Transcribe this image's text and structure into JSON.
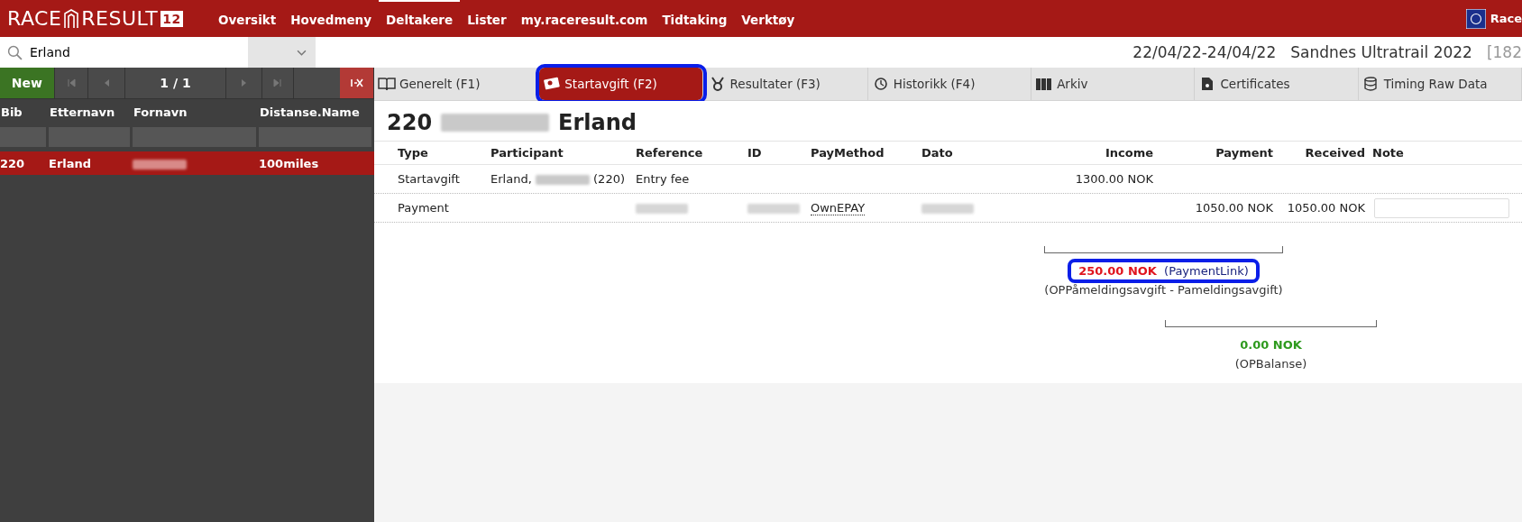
{
  "app": {
    "logo_left": "RACE",
    "logo_right": "RESULT",
    "version": "12",
    "user": "Race"
  },
  "menu": [
    {
      "label": "Oversikt",
      "selected": false
    },
    {
      "label": "Hovedmeny",
      "selected": false
    },
    {
      "label": "Deltakere",
      "selected": true
    },
    {
      "label": "Lister",
      "selected": false
    },
    {
      "label": "my.raceresult.com",
      "selected": false
    },
    {
      "label": "Tidtaking",
      "selected": false
    },
    {
      "label": "Verktøy",
      "selected": false
    }
  ],
  "search": {
    "value": "Erland"
  },
  "event": {
    "dates": "22/04/22-24/04/22",
    "name": "Sandnes Ultratrail 2022",
    "id": "[182"
  },
  "list": {
    "new_button": "New",
    "page": "1 / 1",
    "columns": [
      "Bib",
      "Etternavn",
      "Fornavn",
      "Distanse.Name"
    ],
    "rows": [
      {
        "selected": true,
        "cells": [
          {
            "kind": "text",
            "text": "220"
          },
          {
            "kind": "text",
            "text": "Erland"
          },
          {
            "kind": "redacted"
          },
          {
            "kind": "text",
            "text": "100miles"
          }
        ]
      }
    ]
  },
  "tabs": [
    {
      "label": "Generelt (F1)",
      "selected": false,
      "highlighted": false
    },
    {
      "label": "Startavgift (F2)",
      "selected": true,
      "highlighted": true
    },
    {
      "label": "Resultater (F3)",
      "selected": false,
      "highlighted": false
    },
    {
      "label": "Historikk (F4)",
      "selected": false,
      "highlighted": false
    },
    {
      "label": "Arkiv",
      "selected": false,
      "highlighted": false
    },
    {
      "label": "Certificates",
      "selected": false,
      "highlighted": false
    },
    {
      "label": "Timing Raw Data",
      "selected": false,
      "highlighted": false
    }
  ],
  "participant": {
    "bib": "220",
    "last_name": "Erland"
  },
  "fees": {
    "columns": [
      "Type",
      "Participant",
      "Reference",
      "ID",
      "PayMethod",
      "Dato",
      "Income",
      "Payment",
      "Received",
      "Note"
    ],
    "rows": [
      [
        {
          "kind": "text",
          "text": "Startavgift"
        },
        {
          "kind": "participant",
          "before": "Erland,",
          "after": "(220)"
        },
        {
          "kind": "text",
          "text": "Entry fee"
        },
        {
          "kind": "empty"
        },
        {
          "kind": "empty"
        },
        {
          "kind": "empty"
        },
        {
          "kind": "text",
          "text": "1300.00 NOK"
        },
        {
          "kind": "empty"
        },
        {
          "kind": "empty"
        },
        {
          "kind": "empty"
        }
      ],
      [
        {
          "kind": "text",
          "text": "Payment"
        },
        {
          "kind": "empty"
        },
        {
          "kind": "redacted"
        },
        {
          "kind": "redacted"
        },
        {
          "kind": "link",
          "text": "OwnEPAY"
        },
        {
          "kind": "redacted"
        },
        {
          "kind": "empty"
        },
        {
          "kind": "text",
          "text": "1050.00 NOK"
        },
        {
          "kind": "text",
          "text": "1050.00 NOK"
        },
        {
          "kind": "field"
        }
      ]
    ]
  },
  "summaries": [
    {
      "color": "#e0141e",
      "amount": "250.00 NOK",
      "link": "(PaymentLink)",
      "formula": "(OPPåmeldingsavgift - Pameldingsavgift)",
      "highlighted": true
    },
    {
      "color": "#2e9a1e",
      "amount": "0.00 NOK",
      "formula": "(OPBalanse)",
      "highlighted": false
    }
  ]
}
